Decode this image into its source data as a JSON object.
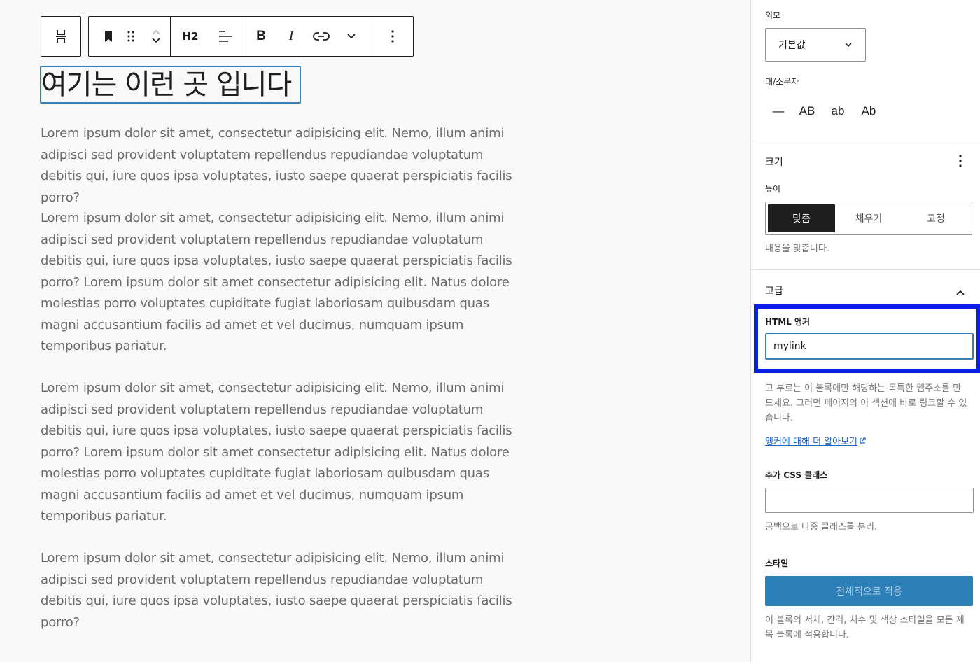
{
  "toolbar": {
    "heading_level": "H2"
  },
  "editor": {
    "heading": "여기는 이런 곳 입니다",
    "paragraphs": [
      "Lorem ipsum dolor sit amet, consectetur adipisicing elit. Nemo, illum animi adipisci sed provident voluptatem repellendus repudiandae voluptatum debitis qui, iure quos ipsa voluptates, iusto saepe quaerat perspiciatis facilis porro?",
      "Lorem ipsum dolor sit amet, consectetur adipisicing elit. Nemo, illum animi adipisci sed provident voluptatem repellendus repudiandae voluptatum debitis qui, iure quos ipsa voluptates, iusto saepe quaerat perspiciatis facilis porro? Lorem ipsum dolor sit amet consectetur adipisicing elit. Natus dolore molestias porro voluptates cupiditate fugiat laboriosam quibusdam quas magni accusantium facilis ad amet et vel ducimus, numquam ipsum temporibus pariatur.",
      "Lorem ipsum dolor sit amet, consectetur adipisicing elit. Nemo, illum animi adipisci sed provident voluptatem repellendus repudiandae voluptatum debitis qui, iure quos ipsa voluptates, iusto saepe quaerat perspiciatis facilis porro? Lorem ipsum dolor sit amet consectetur adipisicing elit. Natus dolore molestias porro voluptates cupiditate fugiat laboriosam quibusdam quas magni accusantium facilis ad amet et vel ducimus, numquam ipsum temporibus pariatur.",
      "Lorem ipsum dolor sit amet, consectetur adipisicing elit. Nemo, illum animi adipisci sed provident voluptatem repellendus repudiandae voluptatum debitis qui, iure quos ipsa voluptates, iusto saepe quaerat perspiciatis facilis porro?"
    ]
  },
  "sidebar": {
    "appearance_label": "외모",
    "appearance_value": "기본값",
    "letter_case_label": "대/소문자",
    "letter_case_options": [
      "—",
      "AB",
      "ab",
      "Ab"
    ],
    "size_title": "크기",
    "height_label": "높이",
    "height_options": [
      "맞춤",
      "채우기",
      "고정"
    ],
    "height_help": "내용을 맞춥니다.",
    "advanced_title": "고급",
    "html_anchor_label": "HTML 앵커",
    "html_anchor_value": "mylink",
    "anchor_help": "고 부르는 이 블록에만 해당하는 독특한 웹주소를 만드세요. 그러면 페이지의 이 섹션에 바로 링크할 수 있습니다.",
    "anchor_link": "앵커에 대해 더 알아보기",
    "css_class_label": "추가 CSS 클래스",
    "css_class_value": "",
    "css_class_help": "공백으로 다중 클래스를 분리.",
    "styles_label": "스타일",
    "apply_button": "전체적으로 적용",
    "styles_help": "이 블록의 서체, 간격, 치수 및 색상 스타일을 모든 제목 블록에 적용합니다."
  }
}
